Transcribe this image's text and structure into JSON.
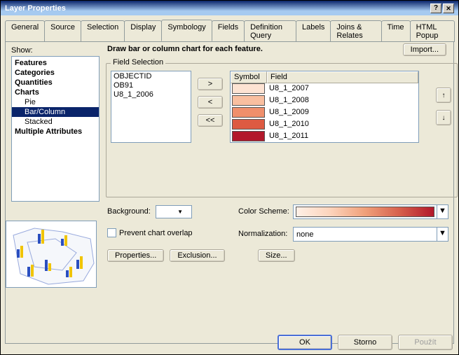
{
  "window": {
    "title": "Layer Properties"
  },
  "tabs": {
    "items": [
      "General",
      "Source",
      "Selection",
      "Display",
      "Symbology",
      "Fields",
      "Definition Query",
      "Labels",
      "Joins & Relates",
      "Time",
      "HTML Popup"
    ],
    "active_index": 4
  },
  "show": {
    "label": "Show:",
    "items": [
      {
        "label": "Features",
        "bold": true,
        "indent": false
      },
      {
        "label": "Categories",
        "bold": true,
        "indent": false
      },
      {
        "label": "Quantities",
        "bold": true,
        "indent": false
      },
      {
        "label": "Charts",
        "bold": true,
        "indent": false
      },
      {
        "label": "Pie",
        "bold": false,
        "indent": true
      },
      {
        "label": "Bar/Column",
        "bold": false,
        "indent": true,
        "selected": true
      },
      {
        "label": "Stacked",
        "bold": false,
        "indent": true
      },
      {
        "label": "Multiple Attributes",
        "bold": true,
        "indent": false
      }
    ]
  },
  "heading": "Draw bar or column chart for each feature.",
  "import_label": "Import...",
  "field_selection": {
    "legend": "Field Selection",
    "available_fields": [
      "OBJECTID",
      "OB91",
      "U8_1_2006"
    ],
    "move_right": ">",
    "move_left": "<",
    "move_all_left": "<<",
    "table": {
      "col_symbol": "Symbol",
      "col_field": "Field",
      "rows": [
        {
          "color": "#fde3d3",
          "field": "U8_1_2007"
        },
        {
          "color": "#f9bfa0",
          "field": "U8_1_2008"
        },
        {
          "color": "#ef8f6c",
          "field": "U8_1_2009"
        },
        {
          "color": "#dd5a42",
          "field": "U8_1_2010"
        },
        {
          "color": "#b2182b",
          "field": "U8_1_2011"
        }
      ]
    },
    "up": "↑",
    "down": "↓"
  },
  "background_label": "Background:",
  "color_scheme_label": "Color Scheme:",
  "prevent_overlap_label": "Prevent chart overlap",
  "normalization_label": "Normalization:",
  "normalization_value": "none",
  "buttons": {
    "properties": "Properties...",
    "exclusion": "Exclusion...",
    "size": "Size..."
  },
  "footer": {
    "ok": "OK",
    "cancel": "Storno",
    "apply": "Použít"
  }
}
